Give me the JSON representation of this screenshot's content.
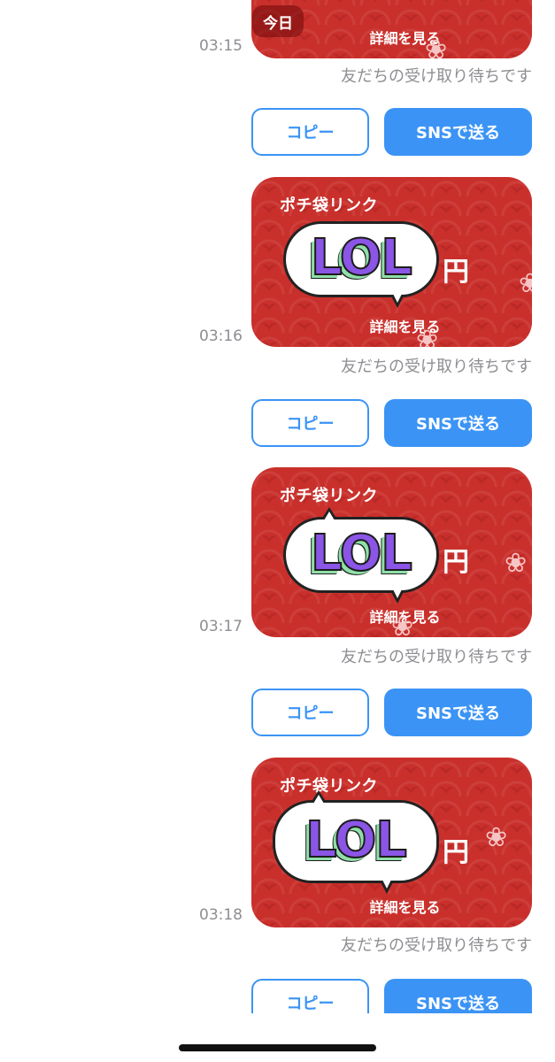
{
  "today_badge": "今日",
  "messages": [
    {
      "time": "03:15",
      "title": "",
      "details": "詳細を見る",
      "status": "友だちの受け取り待ちです",
      "copy": "コピー",
      "sns": "SNSで送る"
    },
    {
      "time": "03:16",
      "title": "ポチ袋リンク",
      "amount": "LOL",
      "currency": "円",
      "details": "詳細を見る",
      "status": "友だちの受け取り待ちです",
      "copy": "コピー",
      "sns": "SNSで送る"
    },
    {
      "time": "03:17",
      "title": "ポチ袋リンク",
      "amount": "LOL",
      "currency": "円",
      "details": "詳細を見る",
      "status": "友だちの受け取り待ちです",
      "copy": "コピー",
      "sns": "SNSで送る"
    },
    {
      "time": "03:18",
      "title": "ポチ袋リンク",
      "amount": "LOL",
      "currency": "円",
      "details": "詳細を見る",
      "status": "友だちの受け取り待ちです",
      "copy": "コピー",
      "sns": "SNSで送る"
    },
    {
      "copy": "コピー",
      "sns": "SNSで送る"
    }
  ],
  "colors": {
    "card_red": "#c9302c",
    "accent_blue": "#3b94f5",
    "gray_text": "#8e8e93"
  },
  "icons": {
    "flower": "plum-blossom-icon"
  }
}
